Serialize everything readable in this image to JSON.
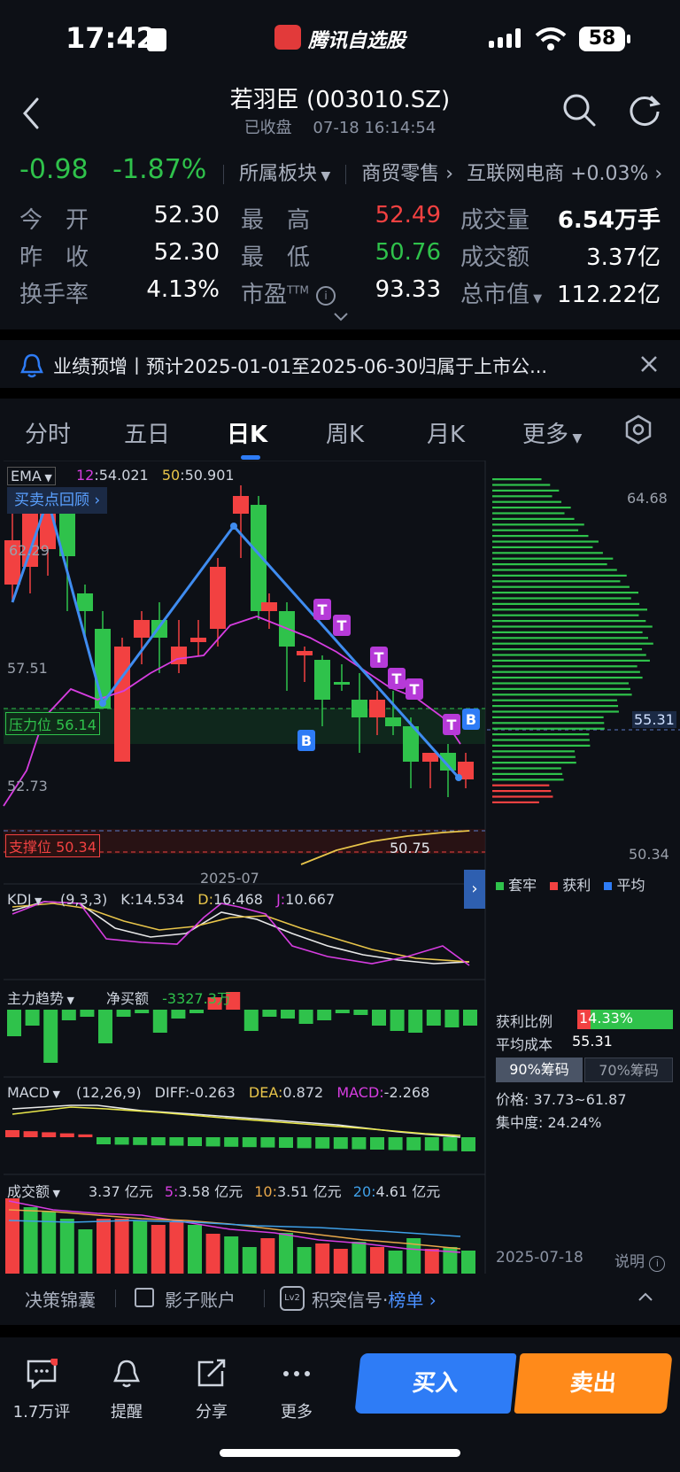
{
  "status_bar": {
    "time": "17:42",
    "app_name": "腾讯自选股",
    "battery": "58"
  },
  "header": {
    "title": "若羽臣 (003010.SZ)",
    "status": "已收盘",
    "datetime": "07-18 16:14:54"
  },
  "quote": {
    "change": "-0.98",
    "change_pct": "-1.87%",
    "sector_label": "所属板块",
    "sector1": "商贸零售",
    "sector2": "互联网电商",
    "sector2_change": "+0.03%"
  },
  "stats": [
    {
      "label": "今　开",
      "value": "52.30"
    },
    {
      "label": "最　高",
      "value": "52.49"
    },
    {
      "label": "成交量",
      "value": "6.54万手"
    },
    {
      "label": "昨　收",
      "value": "52.30"
    },
    {
      "label": "最　低",
      "value": "50.76"
    },
    {
      "label": "成交额",
      "value": "3.37亿"
    },
    {
      "label": "换手率",
      "value": "4.13%"
    },
    {
      "label": "市盈",
      "sub": "TTM",
      "value": "93.33"
    },
    {
      "label": "总市值",
      "value": "112.22亿"
    }
  ],
  "notice": {
    "text": "业绩预增丨预计2025-01-01至2025-06-30归属于上市公..."
  },
  "tabs": [
    "分时",
    "五日",
    "日K",
    "周K",
    "月K",
    "更多"
  ],
  "active_tab": 2,
  "ema": {
    "label": "EMA",
    "p12": "12",
    "v12": ":54.021",
    "p50": "50",
    "v50": ":50.901"
  },
  "review_btn": "买卖点回顾",
  "price_axis": {
    "high": "64.68",
    "top_left": "62.29",
    "mid": "57.51",
    "low_left": "52.73",
    "right_low": "50.34",
    "avg": "55.31"
  },
  "pressure": {
    "label": "压力位",
    "value": "56.14"
  },
  "support": {
    "label": "支撑位",
    "value": "50.34"
  },
  "low_mark": "50.75",
  "date_label": "2025-07",
  "legend": {
    "trapped": "套牢",
    "profit": "获利",
    "avg": "平均"
  },
  "kdj": {
    "label": "KDJ",
    "params": "(9,3,3)",
    "k": "K:14.534",
    "d_name": "D:",
    "d": "16.468",
    "j_name": "J:",
    "j": "10.667"
  },
  "main_force": {
    "label": "主力趋势",
    "net_label": "净买额",
    "net": "-3327.3万"
  },
  "macd": {
    "label": "MACD",
    "params": "(12,26,9)",
    "diff": "DIFF:-0.263",
    "dea_name": "DEA:",
    "dea": "0.872",
    "macd_name": "MACD:",
    "macd": "-2.268"
  },
  "volume": {
    "label": "成交额",
    "v": "3.37 亿元",
    "p5": "5:",
    "v5": "3.58 亿元",
    "p10": "10:",
    "v10": "3.51 亿元",
    "p20": "20:",
    "v20": "4.61 亿元"
  },
  "chips": {
    "profit_label": "获利比例",
    "profit": "14.33%",
    "profit_ratio": 0.1433,
    "avg_label": "平均成本",
    "avg": "55.31",
    "btn90": "90%筹码",
    "btn70": "70%筹码",
    "price_range": "价格: 37.73~61.87",
    "concentration": "集中度: 24.24%",
    "date": "2025-07-18",
    "explain": "说明"
  },
  "footer_links": {
    "a": "决策锦囊",
    "b": "影子账户",
    "c": "积突信号",
    "dot": "·",
    "d": "榜单"
  },
  "nav": [
    {
      "label": "1.7万评"
    },
    {
      "label": "提醒"
    },
    {
      "label": "分享"
    },
    {
      "label": "更多"
    }
  ],
  "buttons": {
    "buy": "买入",
    "sell": "卖出"
  },
  "colors": {
    "up": "#f24141",
    "down": "#2fc24b",
    "accent": "#2e7cf6",
    "sell": "#ff8a1a"
  }
}
